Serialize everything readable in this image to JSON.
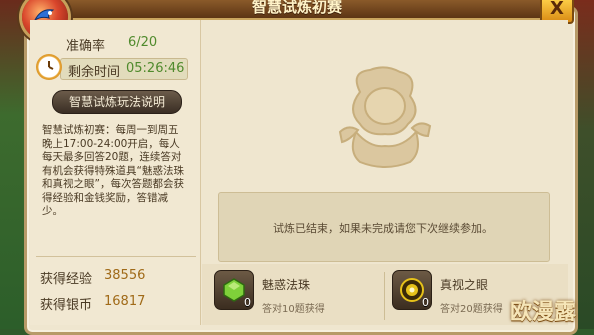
{
  "window": {
    "title": "智慧试炼初赛",
    "close_label": "X"
  },
  "stats": {
    "accuracy_label": "准确率",
    "accuracy_value": "6/20",
    "time_label": "剩余时间",
    "time_value": "05:26:46"
  },
  "rules_button": "智慧试炼玩法说明",
  "description": "智慧试炼初赛：每周一到周五晚上17:00-24:00开启，每人每天最多回答20题，连续答对有机会获得特殊道具“魅惑法珠和真视之眼”，每次答题都会获得经验和金钱奖励，答错减少。",
  "earned": {
    "exp_label": "获得经验",
    "exp_value": "38556",
    "silver_label": "获得银币",
    "silver_value": "16817"
  },
  "message": "试炼已结束，如果未完成请您下次继续参加。",
  "rewards": [
    {
      "name": "魅惑法珠",
      "desc": "答对10题获得",
      "count": "0",
      "icon": "green-gem-icon",
      "color": "#7fd13a"
    },
    {
      "name": "真视之眼",
      "desc": "答对20题获得",
      "count": "0",
      "icon": "golden-eye-icon",
      "color": "#e6c21a"
    }
  ],
  "watermark": "欧漫露"
}
